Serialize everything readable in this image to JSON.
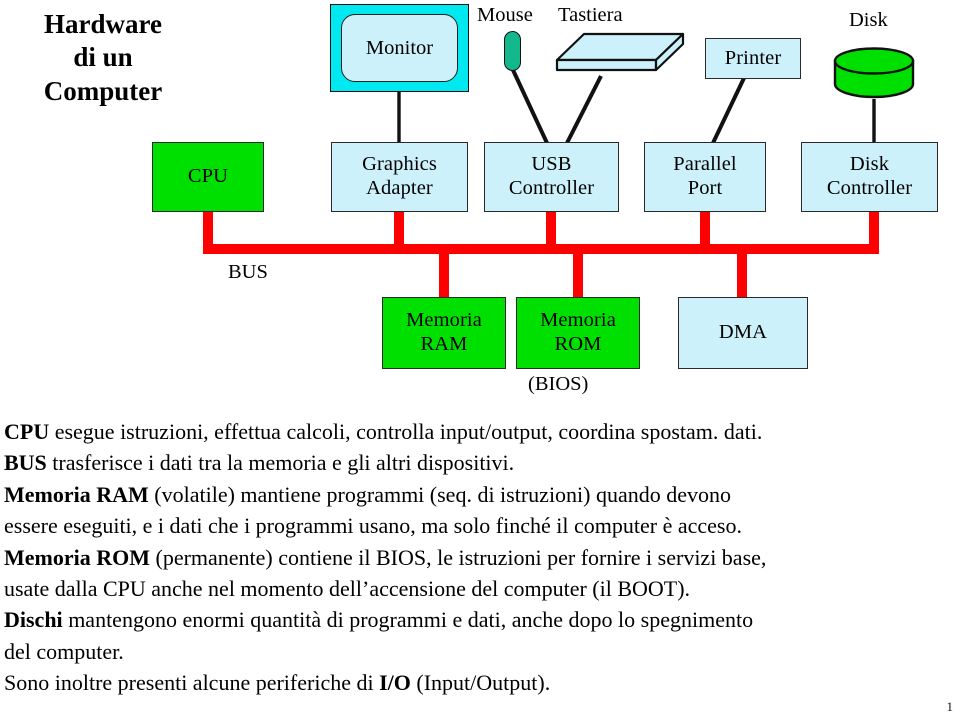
{
  "title": {
    "line1": "Hardware",
    "line2": "di un",
    "line3": "Computer"
  },
  "colors": {
    "green": "#00e000",
    "light_blue": "#cdf1fb",
    "cyan": "#00e8f0",
    "bus_red": "#ff0000",
    "teal": "#13b98c",
    "outline": "#2a2a2a"
  },
  "diagram": {
    "peripherals": [
      {
        "name": "monitor",
        "label": "Monitor",
        "shape": "monitor-crt"
      },
      {
        "name": "mouse",
        "label": "Mouse",
        "shape": "mouse-blob"
      },
      {
        "name": "keyboard",
        "label": "Tastiera",
        "shape": "keyboard-slab"
      },
      {
        "name": "printer",
        "label": "Printer",
        "shape": "box"
      },
      {
        "name": "disk",
        "label": "Disk",
        "shape": "cylinder"
      }
    ],
    "controllers": [
      {
        "name": "cpu",
        "line1": "CPU",
        "line2": "",
        "fill": "green"
      },
      {
        "name": "graphics-adapter",
        "line1": "Graphics",
        "line2": "Adapter",
        "fill": "light_blue"
      },
      {
        "name": "usb-controller",
        "line1": "USB",
        "line2": "Controller",
        "fill": "light_blue"
      },
      {
        "name": "parallel-port",
        "line1": "Parallel",
        "line2": "Port",
        "fill": "light_blue"
      },
      {
        "name": "disk-controller",
        "line1": "Disk",
        "line2": "Controller",
        "fill": "light_blue"
      }
    ],
    "bus_label": "BUS",
    "memories": [
      {
        "name": "memoria-ram",
        "line1": "Memoria",
        "line2": "RAM",
        "fill": "green",
        "caption": ""
      },
      {
        "name": "memoria-rom",
        "line1": "Memoria",
        "line2": "ROM",
        "fill": "green",
        "caption": "(BIOS)"
      },
      {
        "name": "dma",
        "line1": "DMA",
        "line2": "",
        "fill": "light_blue",
        "caption": ""
      }
    ]
  },
  "body": {
    "p1_bold": "CPU",
    "p1_rest": " esegue istruzioni, effettua calcoli, controlla input/output, coordina spostam. dati.",
    "p2_bold": "BUS",
    "p2_rest": " trasferisce i dati tra la memoria e gli altri dispositivi.",
    "p3_bold": "Memoria RAM",
    "p3_rest": " (volatile) mantiene programmi (seq. di istruzioni) quando devono",
    "p4": "essere eseguiti, e i dati che i programmi usano, ma solo finché il computer è acceso.",
    "p5_bold": "Memoria ROM",
    "p5_rest": " (permanente) contiene il BIOS, le istruzioni per fornire i servizi base,",
    "p6": "usate dalla CPU anche nel momento dell’accensione del computer (il BOOT).",
    "p7_bold": "Dischi",
    "p7_rest": " mantengono enormi quantità di programmi e dati, anche dopo lo spegnimento",
    "p8": "del computer.",
    "p9_pre": "Sono inoltre presenti alcune periferiche di ",
    "p9_bold": "I/O",
    "p9_post": " (Input/Output)."
  },
  "page_number": "1"
}
